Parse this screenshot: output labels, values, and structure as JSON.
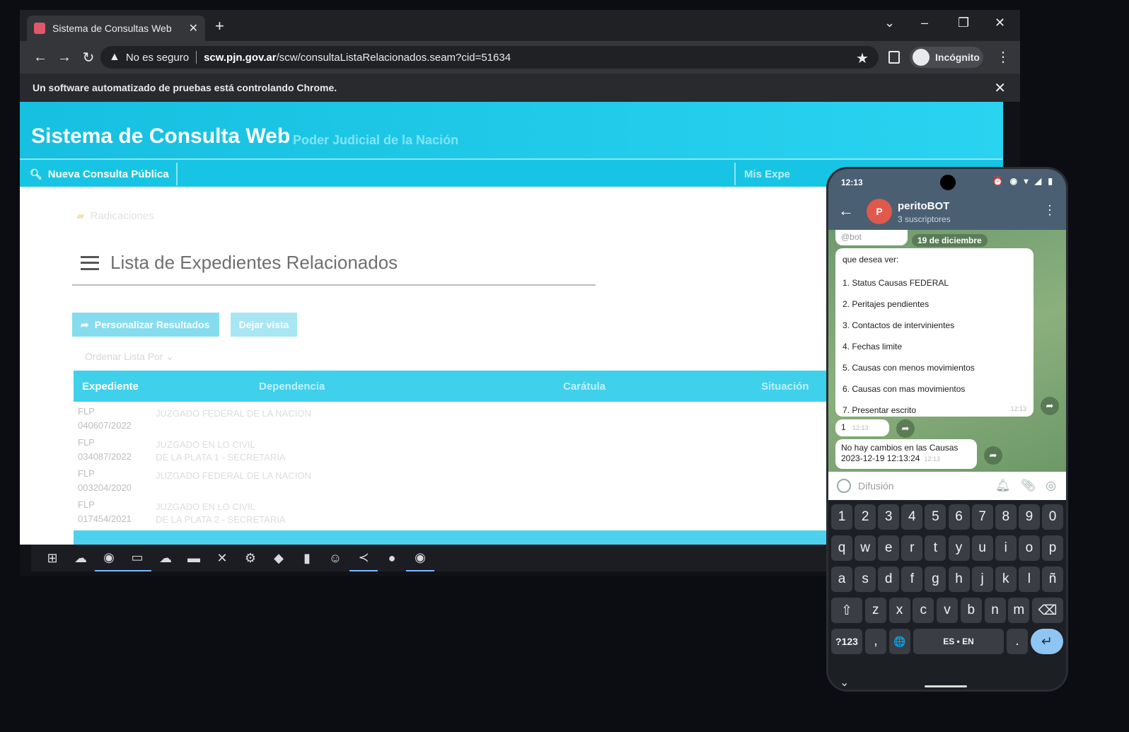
{
  "browser": {
    "tab_title": "Sistema de Consultas Web",
    "tab_close": "✕",
    "new_tab": "+",
    "controls": {
      "tabs_menu": "⌄",
      "minimize": "–",
      "restore": "❐",
      "close": "✕"
    },
    "nav": {
      "back": "←",
      "forward": "→",
      "reload": "↻"
    },
    "security_label": "No es seguro",
    "url_host": "scw.pjn.gov.ar",
    "url_path": "/scw/consultaListaRelacionados.seam?cid=51634",
    "profile_label": "Incógnito",
    "automation_message": "Un software automatizado de pruebas está controlando Chrome.",
    "infobar_close": "✕"
  },
  "site": {
    "title": "Sistema de Consulta Web",
    "subtitle": "Poder Judicial de la Nación",
    "menu_primary": "Nueva Consulta Pública",
    "menu_secondary": "Mis Expe",
    "breadcrumb": "Radicaciones",
    "page_title": "Lista de Expedientes Relacionados",
    "btn_personalizar": "Personalizar Resultados",
    "btn_dejar": "Dejar vista",
    "order_label": "Ordenar Lista Por ⌄",
    "table": {
      "headers": [
        "Expediente",
        "Dependencia",
        "Carátula",
        "Situación"
      ],
      "rows": [
        {
          "expediente": "FLP\n040607/2022",
          "dependencia": "JUZGADO FEDERAL DE LA NACION"
        },
        {
          "expediente": "FLP\n034087/2022",
          "dependencia": "JUZGADO EN LO CIVIL\nDE LA PLATA 1 - SECRETARIA"
        },
        {
          "expediente": "FLP\n003204/2020",
          "dependencia": "JUZGADO FEDERAL DE LA NACION"
        },
        {
          "expediente": "FLP\n017454/2021",
          "dependencia": "JUZGADO EN LO CIVIL\nDE LA PLATA 2 - SECRETARIA"
        }
      ]
    }
  },
  "taskbar": [
    "⊞",
    "☁",
    "◉",
    "▭",
    "☁",
    "▬",
    "✕",
    "⚙",
    "◆",
    "▮",
    "☺",
    "≺",
    "●",
    "◉"
  ],
  "phone": {
    "time": "12:13",
    "status_icons": "⏰ ◉ ▾ ◢ ▮",
    "back": "←",
    "avatar_letter": "P",
    "channel_name": "peritoBOT",
    "subscribers": "3 suscriptores",
    "menu": "⋮",
    "top_bubble": "@bot",
    "date_pill": "19 de diciembre",
    "menu_message": {
      "intro": "que desea ver:",
      "options": [
        "1. Status Causas FEDERAL",
        "2. Peritajes pendientes",
        "3. Contactos de intervinientes",
        "4. Fechas limite",
        "5. Causas con menos movimientos",
        "6. Causas con mas movimientos",
        "7. Presentar escrito"
      ]
    },
    "reply_one": "1",
    "no_change_line1": "No hay cambios en las Causas",
    "no_change_line2": "2023-12-19 12:13:24",
    "msg_time": "12:13",
    "share": "➦",
    "composer_placeholder": "Difusión",
    "keyboard": {
      "numbers": [
        "1",
        "2",
        "3",
        "4",
        "5",
        "6",
        "7",
        "8",
        "9",
        "0"
      ],
      "row1": [
        "q",
        "w",
        "e",
        "r",
        "t",
        "y",
        "u",
        "i",
        "o",
        "p"
      ],
      "row2": [
        "a",
        "s",
        "d",
        "f",
        "g",
        "h",
        "j",
        "k",
        "l",
        "ñ"
      ],
      "row3": [
        "z",
        "x",
        "c",
        "v",
        "b",
        "n",
        "m"
      ],
      "shift": "⇧",
      "backspace": "⌫",
      "symbols": "?123",
      "comma": ",",
      "globe": "🌐",
      "space_label": "ES • EN",
      "period": ".",
      "enter": "↵",
      "hide": "⌄"
    }
  }
}
